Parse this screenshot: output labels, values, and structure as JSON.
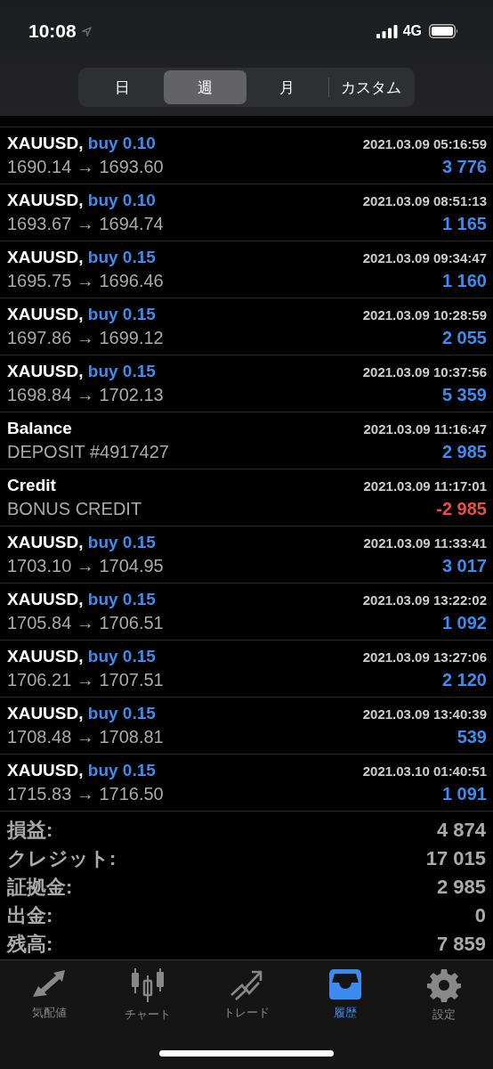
{
  "status_bar": {
    "time": "10:08",
    "network": "4G"
  },
  "period_tabs": [
    {
      "label": "日",
      "selected": false
    },
    {
      "label": "週",
      "selected": true
    },
    {
      "label": "月",
      "selected": false
    },
    {
      "label": "カスタム",
      "selected": false
    }
  ],
  "deals": [
    {
      "kind": "trade",
      "symbol": "XAUUSD,",
      "side": "buy 0.10",
      "time": "2021.03.09 05:16:59",
      "prices": "1690.14 → 1693.60",
      "profit": "3 776",
      "loss": false
    },
    {
      "kind": "trade",
      "symbol": "XAUUSD,",
      "side": "buy 0.10",
      "time": "2021.03.09 08:51:13",
      "prices": "1693.67 → 1694.74",
      "profit": "1 165",
      "loss": false
    },
    {
      "kind": "trade",
      "symbol": "XAUUSD,",
      "side": "buy 0.15",
      "time": "2021.03.09 09:34:47",
      "prices": "1695.75 → 1696.46",
      "profit": "1 160",
      "loss": false
    },
    {
      "kind": "trade",
      "symbol": "XAUUSD,",
      "side": "buy 0.15",
      "time": "2021.03.09 10:28:59",
      "prices": "1697.86 → 1699.12",
      "profit": "2 055",
      "loss": false
    },
    {
      "kind": "trade",
      "symbol": "XAUUSD,",
      "side": "buy 0.15",
      "time": "2021.03.09 10:37:56",
      "prices": "1698.84 → 1702.13",
      "profit": "5 359",
      "loss": false
    },
    {
      "kind": "balance",
      "title": "Balance",
      "time": "2021.03.09 11:16:47",
      "comment": "DEPOSIT #4917427",
      "profit": "2 985",
      "loss": false
    },
    {
      "kind": "balance",
      "title": "Credit",
      "time": "2021.03.09 11:17:01",
      "comment": "BONUS CREDIT",
      "profit": "-2 985",
      "loss": true
    },
    {
      "kind": "trade",
      "symbol": "XAUUSD,",
      "side": "buy 0.15",
      "time": "2021.03.09 11:33:41",
      "prices": "1703.10 → 1704.95",
      "profit": "3 017",
      "loss": false
    },
    {
      "kind": "trade",
      "symbol": "XAUUSD,",
      "side": "buy 0.15",
      "time": "2021.03.09 13:22:02",
      "prices": "1705.84 → 1706.51",
      "profit": "1 092",
      "loss": false
    },
    {
      "kind": "trade",
      "symbol": "XAUUSD,",
      "side": "buy 0.15",
      "time": "2021.03.09 13:27:06",
      "prices": "1706.21 → 1707.51",
      "profit": "2 120",
      "loss": false
    },
    {
      "kind": "trade",
      "symbol": "XAUUSD,",
      "side": "buy 0.15",
      "time": "2021.03.09 13:40:39",
      "prices": "1708.48 → 1708.81",
      "profit": "539",
      "loss": false
    },
    {
      "kind": "trade",
      "symbol": "XAUUSD,",
      "side": "buy 0.15",
      "time": "2021.03.10 01:40:51",
      "prices": "1715.83 → 1716.50",
      "profit": "1 091",
      "loss": false
    }
  ],
  "summary": [
    {
      "label": "損益:",
      "value": "4 874"
    },
    {
      "label": "クレジット:",
      "value": "17 015"
    },
    {
      "label": "証拠金:",
      "value": "2 985"
    },
    {
      "label": "出金:",
      "value": "0"
    },
    {
      "label": "残高:",
      "value": "7 859"
    }
  ],
  "tab_bar": [
    {
      "kind": "quotes",
      "label": "気配値",
      "selected": false
    },
    {
      "kind": "chart",
      "label": "チャート",
      "selected": false
    },
    {
      "kind": "trade",
      "label": "トレード",
      "selected": false
    },
    {
      "kind": "history",
      "label": "履歴",
      "selected": true
    },
    {
      "kind": "settings",
      "label": "設定",
      "selected": false
    }
  ]
}
